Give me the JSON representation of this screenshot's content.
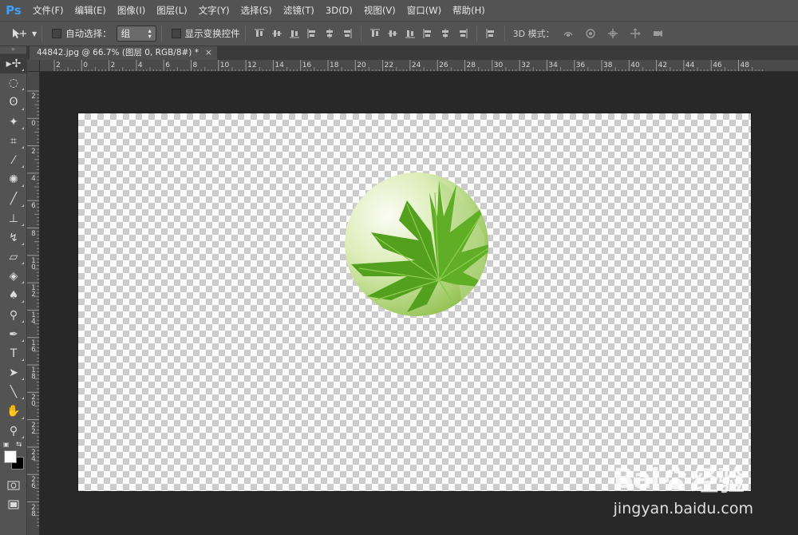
{
  "app": {
    "logo": "Ps"
  },
  "menu": [
    "文件(F)",
    "编辑(E)",
    "图像(I)",
    "图层(L)",
    "文字(Y)",
    "选择(S)",
    "滤镜(T)",
    "3D(D)",
    "视图(V)",
    "窗口(W)",
    "帮助(H)"
  ],
  "options": {
    "auto_select_label": "自动选择：",
    "auto_select_value": "组",
    "show_transform_label": "显示变换控件",
    "mode_3d_label": "3D 模式："
  },
  "document": {
    "tab_title": "44842.jpg @ 66.7% (图层 0, RGB/8#) *",
    "close_glyph": "×"
  },
  "ruler": {
    "h_labels": [
      "2",
      "0",
      "2",
      "4",
      "6",
      "8",
      "10",
      "12",
      "14",
      "16",
      "18",
      "20",
      "22",
      "24",
      "26",
      "28",
      "30",
      "32",
      "34",
      "36",
      "38",
      "40",
      "42",
      "44",
      "46",
      "48"
    ],
    "v_labels": [
      "2",
      "0",
      "2",
      "4",
      "6",
      "8",
      "1\n0",
      "1\n2",
      "1\n4",
      "1\n6",
      "1\n8",
      "2\n0",
      "2\n2",
      "2\n4",
      "2\n6",
      "2\n8"
    ]
  },
  "tools": [
    {
      "name": "move-tool",
      "glyph": "▸✢",
      "active": true
    },
    {
      "name": "marquee-tool",
      "glyph": "◌"
    },
    {
      "name": "lasso-tool",
      "glyph": "ʘ"
    },
    {
      "name": "magic-wand-tool",
      "glyph": "✦"
    },
    {
      "name": "crop-tool",
      "glyph": "⌗"
    },
    {
      "name": "eyedropper-tool",
      "glyph": "⁄"
    },
    {
      "name": "healing-brush-tool",
      "glyph": "✺"
    },
    {
      "name": "brush-tool",
      "glyph": "╱"
    },
    {
      "name": "clone-stamp-tool",
      "glyph": "⊥"
    },
    {
      "name": "history-brush-tool",
      "glyph": "↯"
    },
    {
      "name": "eraser-tool",
      "glyph": "▱"
    },
    {
      "name": "paint-bucket-tool",
      "glyph": "◈"
    },
    {
      "name": "blur-tool",
      "glyph": "♠"
    },
    {
      "name": "dodge-tool",
      "glyph": "⚲"
    },
    {
      "name": "pen-tool",
      "glyph": "✒"
    },
    {
      "name": "type-tool",
      "glyph": "T"
    },
    {
      "name": "path-selection-tool",
      "glyph": "➤"
    },
    {
      "name": "line-tool",
      "glyph": "╲"
    },
    {
      "name": "hand-tool",
      "glyph": "✋"
    },
    {
      "name": "zoom-tool",
      "glyph": "⚲"
    }
  ],
  "colors": {
    "foreground": "#ffffff",
    "background": "#000000",
    "leaf_dark": "#4c9a1f",
    "leaf_light": "#7cc23a",
    "disc_bg": "#cfe6a8"
  },
  "watermark": {
    "brand": "Bai",
    "brand_suffix": "经验",
    "url": "jingyan.baidu.com"
  }
}
